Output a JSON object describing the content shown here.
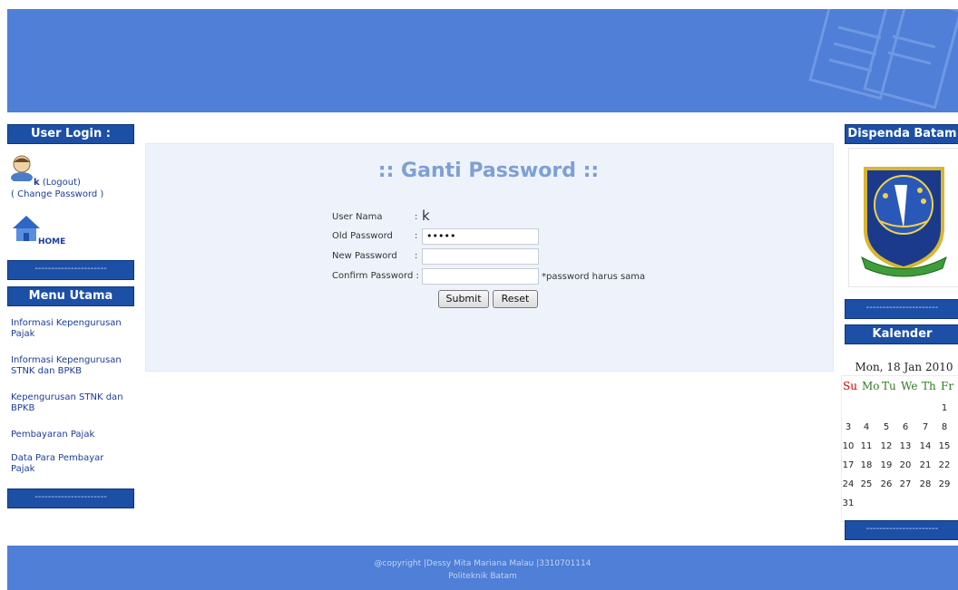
{
  "left": {
    "user_login_title": "User Login :",
    "username": "k",
    "logout_label": "(Logout)",
    "change_password_label": "( Change Password )",
    "home_label": "HOME",
    "dash": "----------------------",
    "menu_title": "Menu Utama",
    "menu_items": [
      "Informasi Kepengurusan Pajak",
      "Informasi Kepengurusan STNK dan BPKB",
      "Kepengurusan STNK dan BPKB",
      "Pembayaran Pajak",
      "Data Para Pembayar Pajak"
    ]
  },
  "form": {
    "title": ":: Ganti Password ::",
    "username_label": "User Nama",
    "username_value": "k",
    "old_password_label": "Old Password",
    "old_password_value": "•••••",
    "new_password_label": "New Password",
    "confirm_password_label": "Confirm Password :",
    "hint": "*password harus sama",
    "colon": ":",
    "submit_label": "Submit",
    "reset_label": "Reset"
  },
  "right": {
    "dispenda_title": "Dispenda Batam",
    "dash": "----------------------",
    "kalender_title": "Kalender",
    "date_label": "Mon, 18 Jan 2010",
    "weekday_headers": [
      "Su",
      "Mo",
      "Tu",
      "We",
      "Th",
      "Fr"
    ],
    "days": [
      [
        "",
        "",
        "",
        "",
        "",
        "1"
      ],
      [
        "3",
        "4",
        "5",
        "6",
        "7",
        "8"
      ],
      [
        "10",
        "11",
        "12",
        "13",
        "14",
        "15"
      ],
      [
        "17",
        "18",
        "19",
        "20",
        "21",
        "22"
      ],
      [
        "24",
        "25",
        "26",
        "27",
        "28",
        "29"
      ],
      [
        "31",
        "",
        "",
        "",
        "",
        ""
      ]
    ]
  },
  "footer": {
    "line1": "@copyright |Dessy Mita Mariana Malau |3310701114",
    "line2": "Politeknik Batam"
  },
  "colors": {
    "header_blue": "#4f7fd6",
    "bar_blue": "#1c4fa6",
    "title_blue": "#7ea0d4",
    "sunday_red": "#cc0000",
    "weekday_green": "#2e7d1f"
  }
}
